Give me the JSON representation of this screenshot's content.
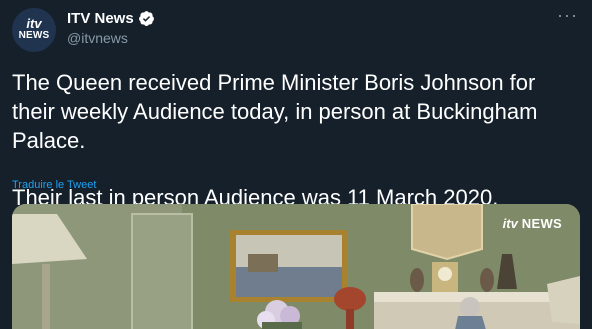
{
  "account": {
    "display_name": "ITV News",
    "handle": "@itvnews",
    "avatar_logo_top": "itv",
    "avatar_logo_bottom": "NEWS",
    "verified": true
  },
  "tweet": {
    "paragraph_1": "The Queen received Prime Minister Boris Johnson for their weekly Audience today, in person at Buckingham Palace.",
    "paragraph_2": "Their last in person Audience was 11 March 2020.",
    "translate_label": "Traduire le Tweet"
  },
  "media": {
    "watermark_itv": "itv",
    "watermark_news": "NEWS"
  },
  "icons": {
    "more": "more-icon",
    "verified": "verified-badge-icon"
  },
  "colors": {
    "background": "#15202b",
    "secondary_text": "#8899a6",
    "link": "#1da1f2",
    "verified": "#1da1f2"
  }
}
